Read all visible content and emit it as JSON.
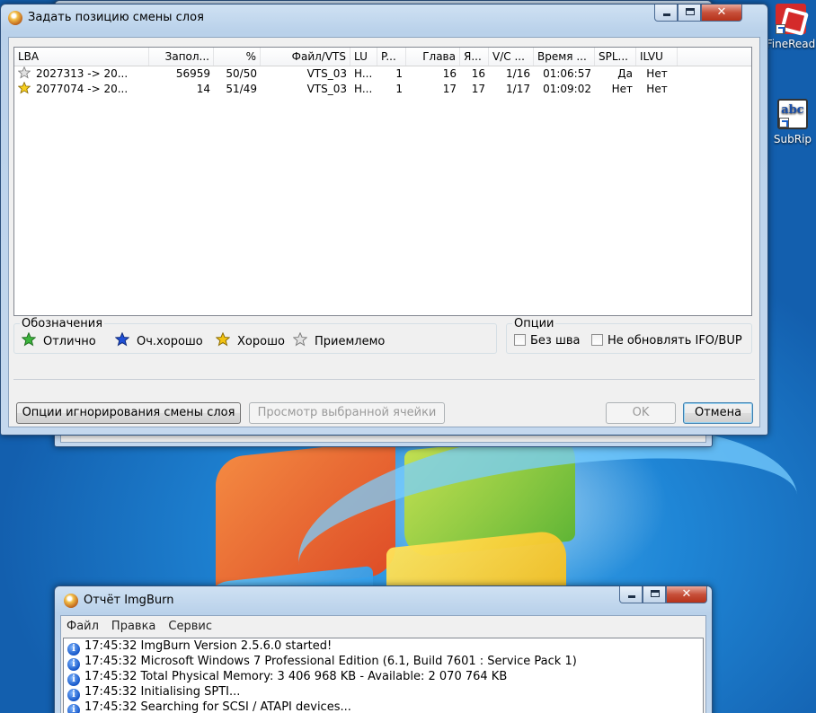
{
  "desktop": {
    "icons": [
      {
        "label": "FineRead"
      },
      {
        "label": "SubRip",
        "glyph": "abc"
      }
    ]
  },
  "dialog": {
    "title": "Задать позицию смены слоя",
    "caption": {
      "minimize": "minimize-icon",
      "maximize": "maximize-icon",
      "close": "✕"
    },
    "list": {
      "columns": [
        "LBA",
        "Запол...",
        "%",
        "Файл/VTS",
        "LU",
        "P...",
        "Глава",
        "Я...",
        "V/C ...",
        "Время ...",
        "SPL...",
        "ILVU"
      ],
      "rows": [
        {
          "rating": "acceptable",
          "lba": "2027313 -> 20...",
          "fill": "56959",
          "pct": "50/50",
          "file": "VTS_03",
          "lu": "H...",
          "p": "1",
          "chapter": "16",
          "cell": "16",
          "vc": "1/16",
          "time": "01:06:57",
          "spl": "Да",
          "ilvu": "Нет"
        },
        {
          "rating": "good",
          "lba": "2077074 -> 20...",
          "fill": "14",
          "pct": "51/49",
          "file": "VTS_03",
          "lu": "H...",
          "p": "1",
          "chapter": "17",
          "cell": "17",
          "vc": "1/17",
          "time": "01:09:02",
          "spl": "Нет",
          "ilvu": "Нет"
        }
      ]
    },
    "legend": {
      "title": "Обозначения",
      "items": [
        {
          "label": "Отлично",
          "color": "#3cb43c"
        },
        {
          "label": "Оч.хорошо",
          "color": "#1f4fd6"
        },
        {
          "label": "Хорошо",
          "color": "#f2c313"
        },
        {
          "label": "Приемлемо",
          "color": "#d0d0d0"
        }
      ]
    },
    "options": {
      "title": "Опции",
      "no_seam": "Без шва",
      "no_update": "Не обновлять IFO/BUP"
    },
    "buttons": {
      "ignore_options": "Опции игнорирования смены слоя",
      "view_cell": "Просмотр выбранной ячейки",
      "ok": "OK",
      "cancel": "Отмена"
    }
  },
  "report": {
    "title": "Отчёт ImgBurn",
    "menu": [
      "Файл",
      "Правка",
      "Сервис"
    ],
    "lines": [
      "17:45:32 ImgBurn Version 2.5.6.0 started!",
      "17:45:32 Microsoft Windows 7 Professional Edition (6.1, Build 7601 : Service Pack 1)",
      "17:45:32 Total Physical Memory: 3 406 968 KB  -  Available: 2 070 764 KB",
      "17:45:32 Initialising SPTI...",
      "17:45:32 Searching for SCSI / ATAPI devices..."
    ]
  }
}
